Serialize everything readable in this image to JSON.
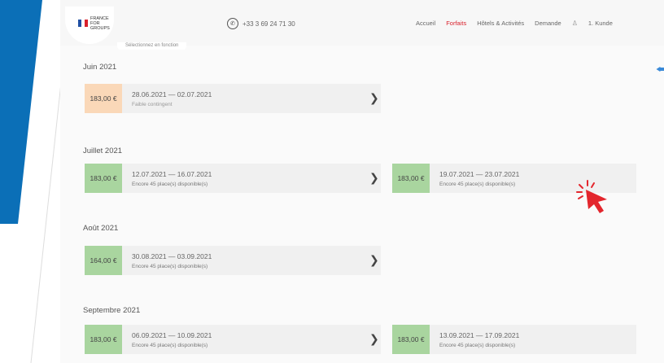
{
  "header": {
    "logo_text": [
      "FRANCE",
      "FOR",
      "GROUPS"
    ],
    "phone": "+33 3 69 24 71 30",
    "nav": {
      "home": "Accueil",
      "packages": "Forfaits",
      "hotels": "Hôtels & Activités",
      "request": "Demande",
      "user": "1. Kunde"
    },
    "sub_tab": "Sélectionnez en fonction"
  },
  "colors": {
    "accent_blue": "#0b6fb7",
    "active_red": "#d9212c",
    "price_green": "#a9d59f",
    "price_orange": "#fad8b8"
  },
  "months": [
    {
      "name": "Juin 2021",
      "slots": [
        {
          "price": "183,00 €",
          "dates": "28.06.2021 — 02.07.2021",
          "availability": "Faible contingent",
          "price_color": "orange"
        }
      ]
    },
    {
      "name": "Juillet 2021",
      "slots": [
        {
          "price": "183,00 €",
          "dates": "12.07.2021 — 16.07.2021",
          "availability": "Encore 45 place(s) disponible(s)",
          "price_color": "green"
        },
        {
          "price": "183,00 €",
          "dates": "19.07.2021 — 23.07.2021",
          "availability": "Encore 45 place(s) disponible(s)",
          "price_color": "green"
        }
      ]
    },
    {
      "name": "Août 2021",
      "slots": [
        {
          "price": "164,00 €",
          "dates": "30.08.2021 — 03.09.2021",
          "availability": "Encore 45 place(s) disponible(s)",
          "price_color": "green"
        }
      ]
    },
    {
      "name": "Septembre 2021",
      "slots": [
        {
          "price": "183,00 €",
          "dates": "06.09.2021 — 10.09.2021",
          "availability": "Encore 45 place(s) disponible(s)",
          "price_color": "green"
        },
        {
          "price": "183,00 €",
          "dates": "13.09.2021 — 17.09.2021",
          "availability": "Encore 45 place(s) disponible(s)",
          "price_color": "green"
        }
      ]
    }
  ],
  "icons": {
    "chevron": "chevron-right-icon",
    "phone": "phone-icon",
    "user": "user-icon",
    "back": "back-arrow-icon",
    "cursor": "click-cursor-icon"
  }
}
